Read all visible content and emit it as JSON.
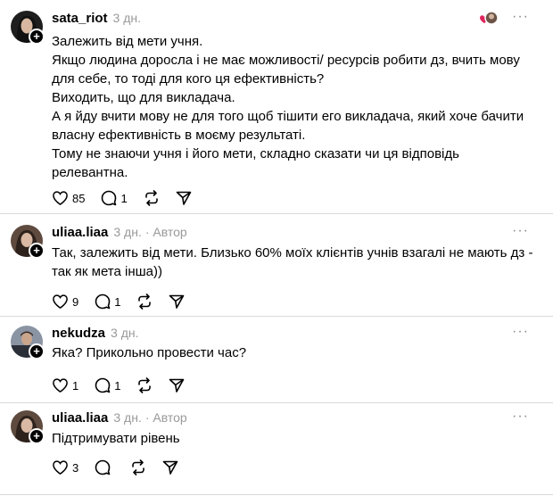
{
  "comments": [
    {
      "username": "sata_riot",
      "time": "3 дн.",
      "author_badge": "",
      "paragraphs": [
        "Залежить від мети учня.",
        "Якщо людина доросла і не має можливості/ ресурсів робити дз, вчить мову для себе, то тоді для кого ця ефективність?",
        "Виходить, що для викладача.",
        "А я йду вчити мову не для того щоб тішити его викладача, який хоче бачити власну ефективність в моєму результаті.",
        "Тому не знаючи учня і його мети, складно сказати чи ця відповідь релевантна."
      ],
      "likes": "85",
      "replies": "1",
      "avatar_color": "#2b2b2b"
    },
    {
      "username": "uliaa.liaa",
      "time": "3 дн.",
      "author_badge": "· Автор",
      "paragraphs": [
        "Так, залежить від мети. Близько 60% моїх клієнтів учнів взагалі не мають дз - так як мета інша))"
      ],
      "likes": "9",
      "replies": "1",
      "avatar_color": "#6b5446"
    },
    {
      "username": "nekudza",
      "time": "3 дн.",
      "author_badge": "",
      "paragraphs": [
        "Яка? Прикольно провести час?"
      ],
      "likes": "1",
      "replies": "1",
      "avatar_color": "#3d4452"
    },
    {
      "username": "uliaa.liaa",
      "time": "3 дн.",
      "author_badge": "· Автор",
      "paragraphs": [
        "Підтримувати рівень"
      ],
      "likes": "3",
      "replies": "",
      "avatar_color": "#6b5446"
    }
  ],
  "icons": {
    "like": "heart-icon",
    "reply": "comment-icon",
    "repost": "repost-icon",
    "share": "send-icon",
    "more": "more-icon"
  }
}
